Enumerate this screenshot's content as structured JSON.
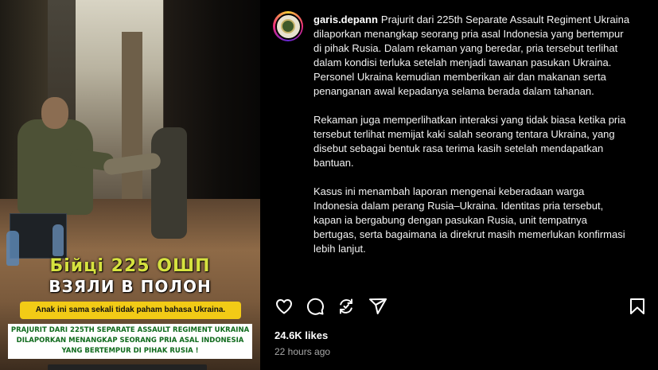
{
  "video": {
    "headline_line1": "Бійці 225 ОШП",
    "headline_line2": "ВЗЯЛИ В ПОЛОН",
    "yellow_caption": "Anak ini sama sekali tidak paham bahasa Ukraina.",
    "white_caption": "PRAJURIT DARI 225TH SEPARATE ASSAULT REGIMENT UKRAINA DILAPORKAN MENANGKAP SEORANG PRIA ASAL INDONESIA YANG BERTEMPUR DI PIHAK RUSIA !"
  },
  "post": {
    "username": "garis.depann",
    "caption_p1": "Prajurit dari 225th Separate Assault Regiment Ukraina dilaporkan menangkap seorang pria asal Indonesia yang bertempur di pihak Rusia. Dalam rekaman yang beredar, pria tersebut terlihat dalam kondisi terluka setelah menjadi tawanan pasukan Ukraina. Personel Ukraina kemudian memberikan air dan makanan serta penanganan awal kepadanya selama berada dalam tahanan.",
    "caption_p2": "Rekaman juga memperlihatkan interaksi yang tidak biasa ketika pria tersebut terlihat memijat kaki salah seorang tentara Ukraina, yang disebut sebagai bentuk rasa terima kasih setelah mendapatkan bantuan.",
    "caption_p3": "Kasus ini menambah laporan mengenai keberadaan warga Indonesia dalam perang Rusia–Ukraina. Identitas pria tersebut, kapan ia bergabung dengan pasukan Rusia, unit tempatnya bertugas, serta bagaimana ia direkrut masih memerlukan konfirmasi lebih lanjut.",
    "likes": "24.6K likes",
    "time_ago": "22 hours ago"
  },
  "icons": {
    "like": "heart-icon",
    "comment": "comment-icon",
    "share": "repost-icon",
    "send": "send-icon",
    "save": "bookmark-icon"
  },
  "colors": {
    "background": "#000000",
    "headline_yellow": "#d6e23f",
    "caption_yellow": "#f2cb16",
    "white_caption_text": "#0f6a1c",
    "muted_text": "#a8a8a8"
  }
}
